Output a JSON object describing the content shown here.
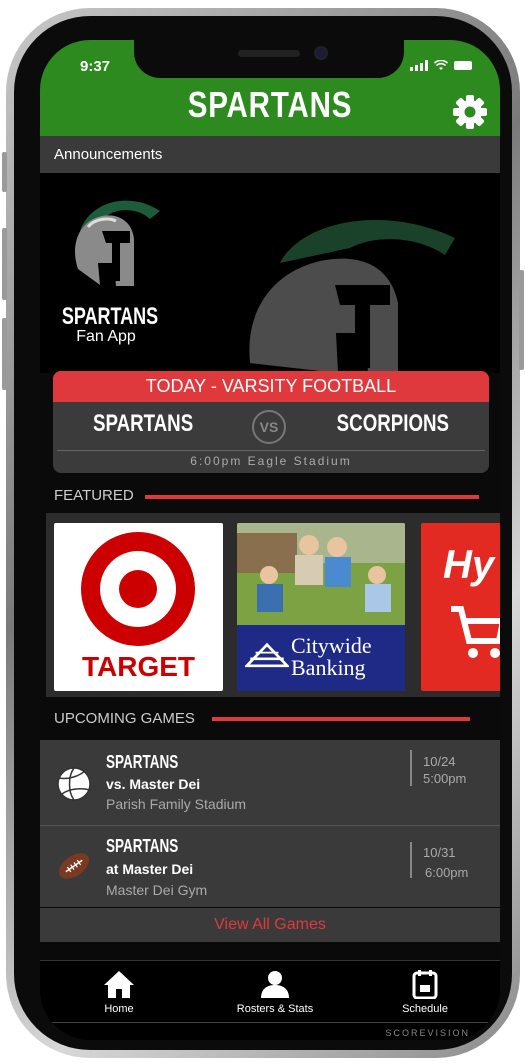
{
  "status_bar": {
    "time": "9:37"
  },
  "header": {
    "title": "SPARTANS",
    "settings_icon": "gear-icon"
  },
  "announcements": {
    "label": "Announcements"
  },
  "hero": {
    "brand_name": "SPARTANS",
    "brand_sub": "Fan App"
  },
  "today": {
    "heading": "TODAY - VARSITY FOOTBALL",
    "home_team": "SPARTANS",
    "vs": "VS",
    "away_team": "SCORPIONS",
    "info": "6:00pm Eagle Stadium"
  },
  "featured": {
    "label": "FEATURED",
    "sponsors": [
      {
        "name": "TARGET"
      },
      {
        "name": "Citywide",
        "name2": "Banking"
      },
      {
        "name": "Hy"
      }
    ]
  },
  "upcoming": {
    "label": "UPCOMING GAMES",
    "games": [
      {
        "team": "SPARTANS",
        "opponent": "vs. Master Dei",
        "venue": "Parish Family Stadium",
        "date": "10/24",
        "time": "5:00pm",
        "icon": "volleyball-icon"
      },
      {
        "team": "SPARTANS",
        "opponent": "at Master Dei",
        "venue": "Master Dei Gym",
        "date": "10/31",
        "time": "6:00pm",
        "icon": "football-icon"
      }
    ],
    "view_all": "View All Games"
  },
  "tabs": [
    {
      "label": "Home",
      "icon": "home-icon"
    },
    {
      "label": "Rosters & Stats",
      "icon": "person-icon"
    },
    {
      "label": "Schedule",
      "icon": "calendar-icon"
    }
  ],
  "footer_brand": "SCOREVISION",
  "colors": {
    "header_green": "#2d8a1f",
    "accent_red": "#e0393d",
    "panel_gray": "#3a3a3a"
  }
}
